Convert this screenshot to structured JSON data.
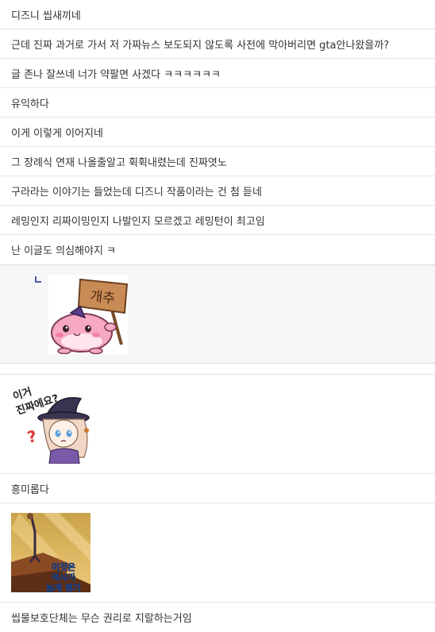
{
  "comments": [
    {
      "text": "디즈니 씹새끼네"
    },
    {
      "text": "근데 진짜 과거로 가서 저 가짜뉴스 보도되지 않도록 사전에 막아버리면 gta안나왔을까?"
    },
    {
      "text": "글 존나 잘쓰네 너가 약팔면 사겠다 ㅋㅋㅋㅋㅋㅋ"
    },
    {
      "text": "유익하다"
    },
    {
      "text": "이게 이렇게 이어지네"
    },
    {
      "text": "그 장례식 연재 나올줄알고 휙휙내렸는데 진짜엿노"
    },
    {
      "text": "구라라는 이야기는 들었는데 디즈니 작품이라는 건 첨 듣네"
    },
    {
      "text": "레밍인지 리짜이밍인지 나발인지 모르겠고 레밍턴이 최고임"
    },
    {
      "text": "난 이글도 의심해야지 ㅋ"
    }
  ],
  "reply_sticker": {
    "sign_text": "개추",
    "icon": "pink-creature-sticker"
  },
  "sticker_question": {
    "caption_line1": "이거",
    "caption_line2": "진짜에요?",
    "mark": "?",
    "icon": "witch-girl-sticker"
  },
  "comment_after_sticker": {
    "text": "흥미롭다"
  },
  "sticker_history": {
    "line1": "이것은",
    "line2": "역사가",
    "line3": "높게 평가",
    "icon": "lion-king-sticker"
  },
  "last_comment": {
    "text": "씹물보호단체는 무슨 권리로 지랄하는거임"
  },
  "colors": {
    "divider": "#e6e6e6",
    "reply_bg": "#f6f6f6",
    "text": "#333333",
    "reply_mark": "#4a5aa6"
  }
}
